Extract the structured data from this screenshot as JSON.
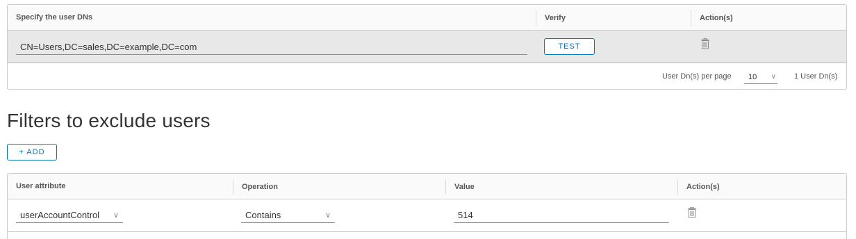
{
  "dn_table": {
    "headers": {
      "specify": "Specify the user DNs",
      "verify": "Verify",
      "actions": "Action(s)"
    },
    "rows": [
      {
        "dn_value": "CN=Users,DC=sales,DC=example,DC=com",
        "test_label": "TEST"
      }
    ],
    "footer": {
      "per_page_label": "User Dn(s) per page",
      "per_page_value": "10",
      "count_label": "1 User Dn(s)"
    }
  },
  "filters": {
    "title": "Filters to exclude users",
    "add_label": "+ ADD",
    "headers": {
      "attribute": "User attribute",
      "operation": "Operation",
      "value": "Value",
      "actions": "Action(s)"
    },
    "rows": [
      {
        "attribute": "userAccountControl",
        "operation": "Contains",
        "value": "514"
      }
    ]
  },
  "icons": {
    "delete": "trash-icon",
    "dropdown": "chevron-down-icon"
  },
  "colors": {
    "accent": "#0079b8",
    "selected_row": "#e8e8e8",
    "border": "#cccccc"
  }
}
